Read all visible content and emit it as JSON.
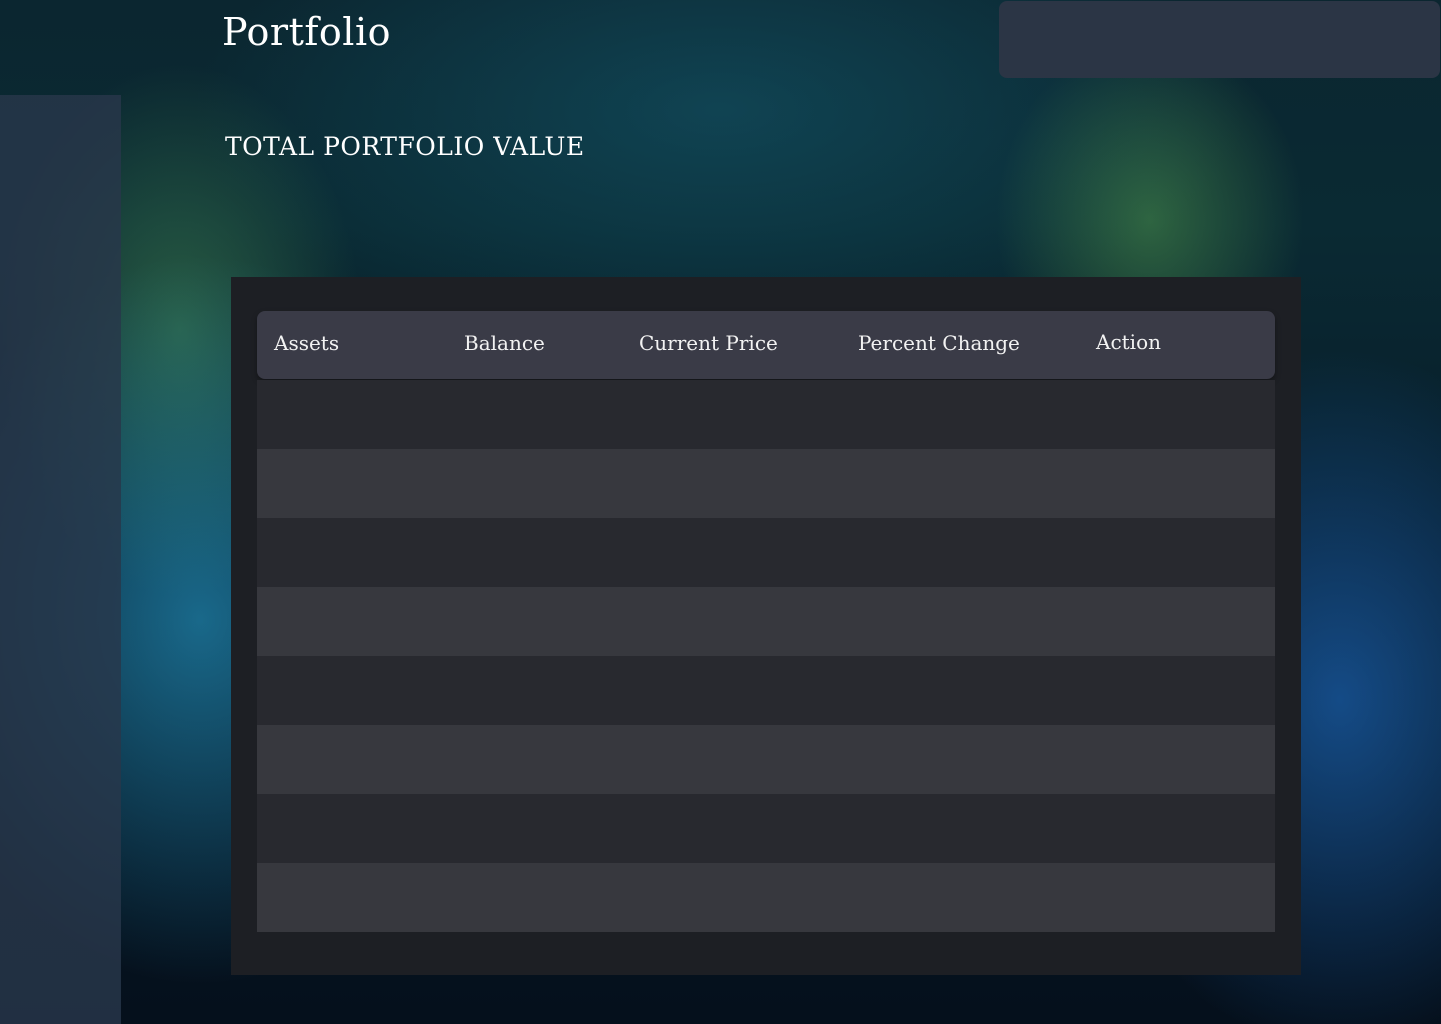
{
  "header": {
    "title": "Portfolio"
  },
  "summary": {
    "total_label": "TOTAL PORTFOLIO VALUE"
  },
  "table": {
    "columns": [
      "Assets",
      "Balance",
      "Current Price",
      "Percent Change",
      "Action"
    ],
    "row_count": 8
  }
}
